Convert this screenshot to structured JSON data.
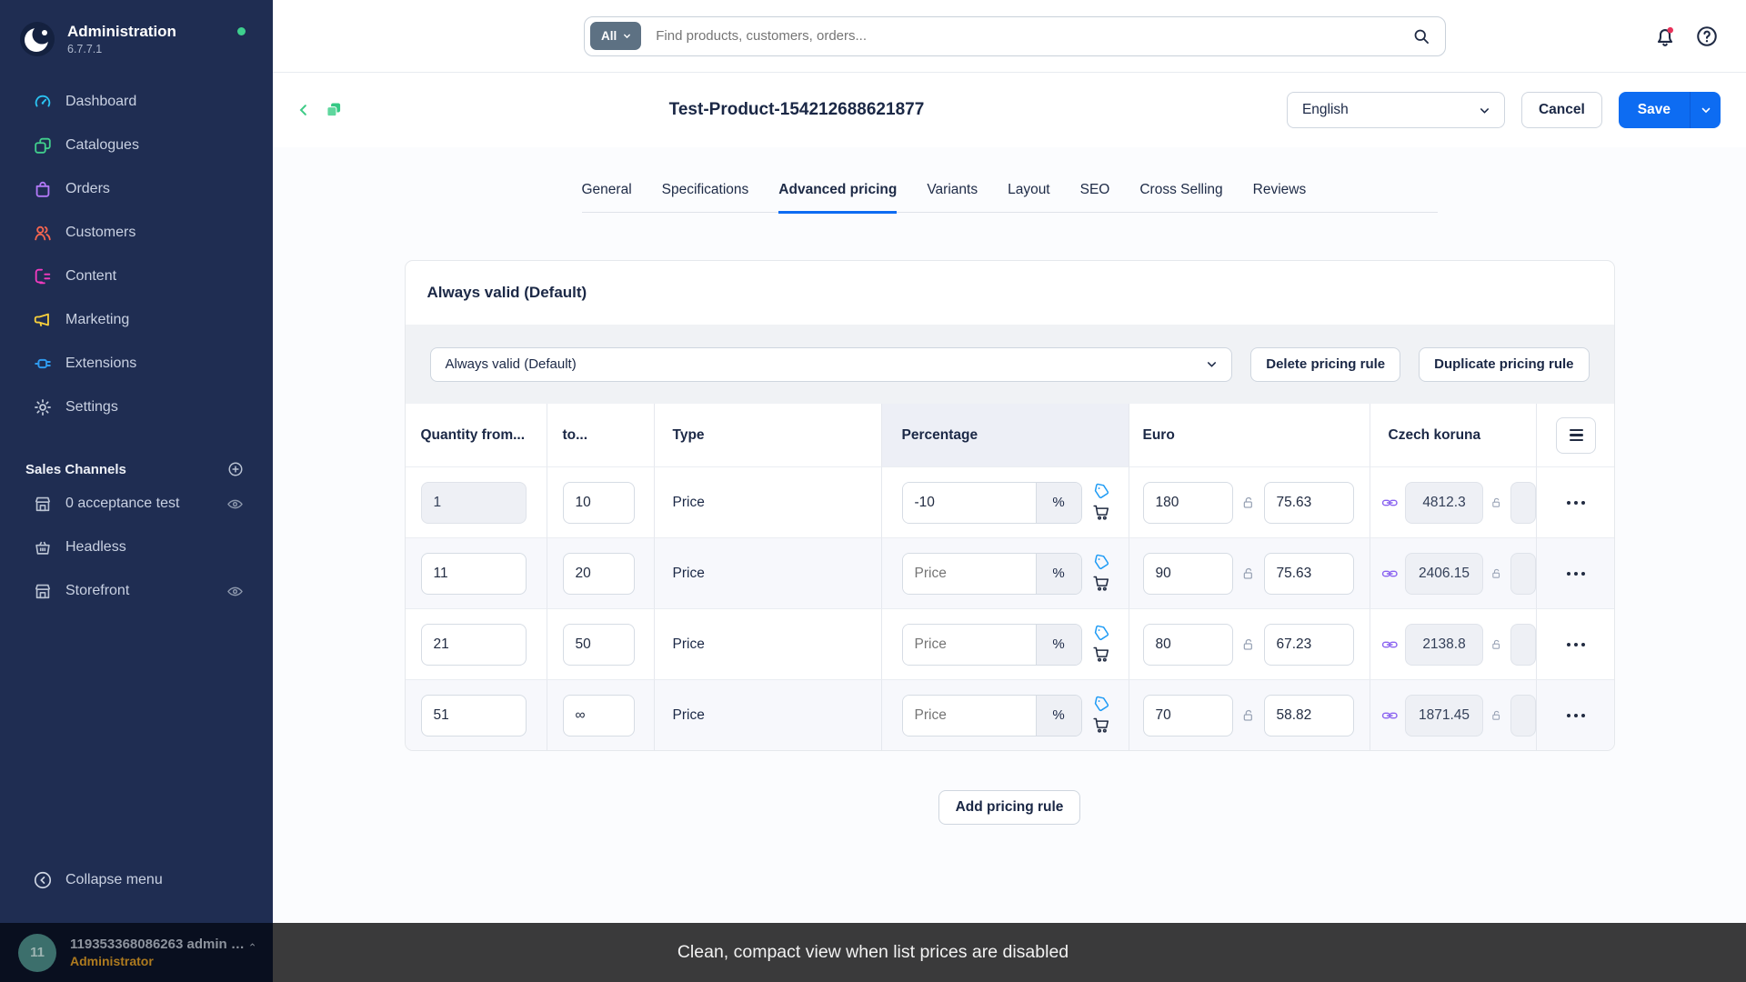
{
  "colors": {
    "accent_blue": "#0d6cf2",
    "brand_green": "#3ecb86",
    "sidebar_navy": "#1f2d52",
    "link_purple": "#8a63f0",
    "tag_blue": "#1e9bf5",
    "notification_red": "#e8325a",
    "role_orange": "#ad7a1f",
    "caption_bg": "#3a3a3b"
  },
  "sidebar": {
    "app_title": "Administration",
    "version": "6.7.7.1",
    "items": [
      {
        "label": "Dashboard"
      },
      {
        "label": "Catalogues"
      },
      {
        "label": "Orders"
      },
      {
        "label": "Customers"
      },
      {
        "label": "Content"
      },
      {
        "label": "Marketing"
      },
      {
        "label": "Extensions"
      },
      {
        "label": "Settings"
      }
    ],
    "sales_channels_label": "Sales Channels",
    "channels": [
      {
        "label": "0 acceptance test"
      },
      {
        "label": "Headless"
      },
      {
        "label": "Storefront"
      }
    ],
    "collapse_label": "Collapse menu",
    "user": {
      "initials": "11",
      "name": "119353368086263 admin …",
      "role": "Administrator"
    }
  },
  "topbar": {
    "search_filter": "All",
    "search_placeholder": "Find products, customers, orders..."
  },
  "smartbar": {
    "title": "Test-Product-154212688621877",
    "language": "English",
    "cancel_label": "Cancel",
    "save_label": "Save"
  },
  "tabs": [
    {
      "label": "General"
    },
    {
      "label": "Specifications"
    },
    {
      "label": "Advanced pricing"
    },
    {
      "label": "Variants"
    },
    {
      "label": "Layout"
    },
    {
      "label": "SEO"
    },
    {
      "label": "Cross Selling"
    },
    {
      "label": "Reviews"
    }
  ],
  "card": {
    "title": "Always valid (Default)",
    "rule_select_value": "Always valid (Default)",
    "delete_label": "Delete pricing rule",
    "duplicate_label": "Duplicate pricing rule",
    "add_rule_label": "Add pricing rule",
    "percent_suffix": "%",
    "columns": {
      "from": "Quantity from...",
      "to": "to...",
      "type": "Type",
      "percentage": "Percentage",
      "euro": "Euro",
      "koruna": "Czech koruna"
    },
    "rows": [
      {
        "from": "1",
        "to": "10",
        "type": "Price",
        "pct_value": "-10",
        "pct_placeholder": "",
        "euro_gross": "180",
        "euro_net": "75.63",
        "koruna": "4812.3"
      },
      {
        "from": "11",
        "to": "20",
        "type": "Price",
        "pct_value": "",
        "pct_placeholder": "Price",
        "euro_gross": "90",
        "euro_net": "75.63",
        "koruna": "2406.15"
      },
      {
        "from": "21",
        "to": "50",
        "type": "Price",
        "pct_value": "",
        "pct_placeholder": "Price",
        "euro_gross": "80",
        "euro_net": "67.23",
        "koruna": "2138.8"
      },
      {
        "from": "51",
        "to": "∞",
        "type": "Price",
        "pct_value": "",
        "pct_placeholder": "Price",
        "euro_gross": "70",
        "euro_net": "58.82",
        "koruna": "1871.45"
      }
    ]
  },
  "caption": "Clean, compact view when list prices are disabled"
}
